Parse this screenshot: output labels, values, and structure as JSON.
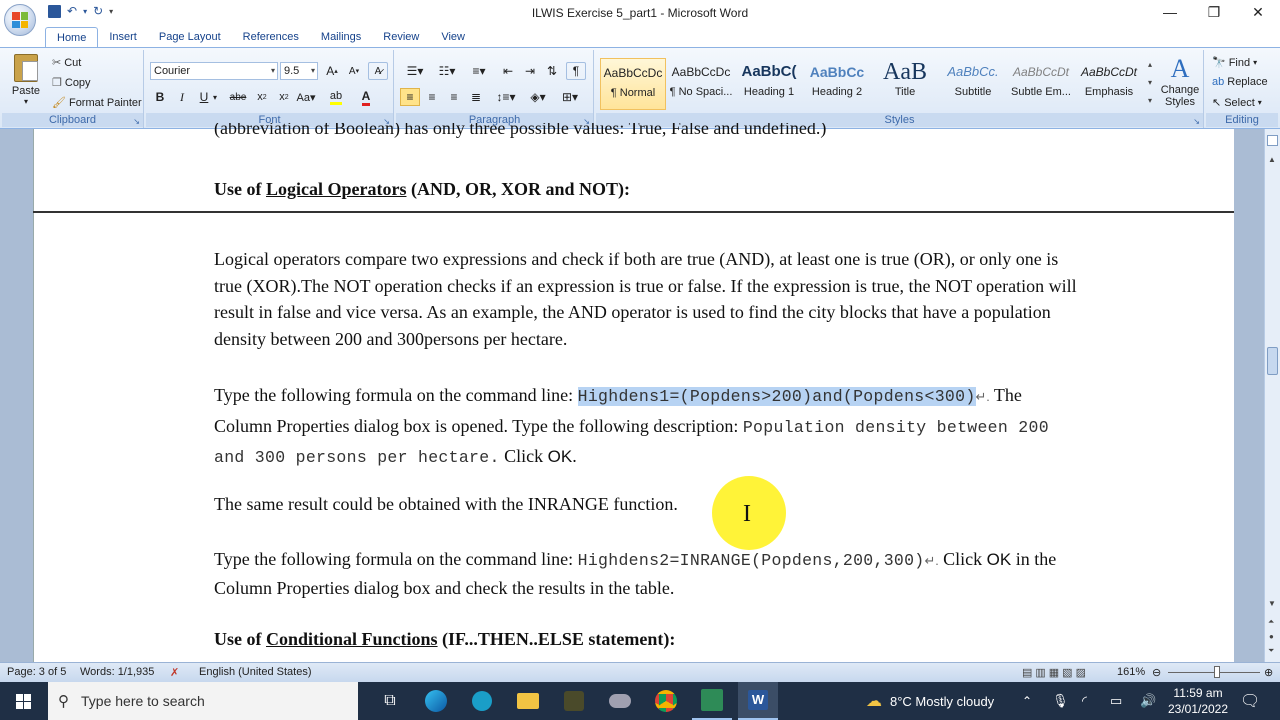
{
  "window": {
    "title": "ILWIS Exercise 5_part1 - Microsoft Word"
  },
  "tabs": [
    "Home",
    "Insert",
    "Page Layout",
    "References",
    "Mailings",
    "Review",
    "View"
  ],
  "clipboard": {
    "paste": "Paste",
    "cut": "Cut",
    "copy": "Copy",
    "format_painter": "Format Painter",
    "label": "Clipboard"
  },
  "font": {
    "name": "Courier",
    "size": "9.5",
    "label": "Font"
  },
  "paragraph": {
    "label": "Paragraph"
  },
  "styles": {
    "label": "Styles",
    "items": [
      {
        "preview": "AaBbCcDc",
        "name": "¶ Normal"
      },
      {
        "preview": "AaBbCcDc",
        "name": "¶ No Spaci..."
      },
      {
        "preview": "AaBbC(",
        "name": "Heading 1"
      },
      {
        "preview": "AaBbCc",
        "name": "Heading 2"
      },
      {
        "preview": "AaB",
        "name": "Title"
      },
      {
        "preview": "AaBbCc.",
        "name": "Subtitle"
      },
      {
        "preview": "AaBbCcDt",
        "name": "Subtle Em..."
      },
      {
        "preview": "AaBbCcDt",
        "name": "Emphasis"
      }
    ],
    "change": "Change Styles"
  },
  "editing": {
    "find": "Find",
    "replace": "Replace",
    "select": "Select",
    "label": "Editing"
  },
  "document": {
    "top_partial": "(abbreviation of Boolean) has only three possible values: True, False and undefined.)",
    "heading1_pre": "Use of ",
    "heading1_link": "Logical Operators",
    "heading1_post": " (AND, OR, XOR and NOT):",
    "para1": "Logical operators compare two expressions and check if both are true (AND), at least one is true (OR), or only one is true (XOR).The NOT operation checks if an expression is true or false. If the expression is true, the NOT operation will result in false and vice versa. As an example, the AND operator is used to find the city blocks that have a population density between 200 and 300persons per hectare.",
    "para2_pre": "Type the following formula on the command line: ",
    "para2_code": "Highdens1=(Popdens>200)and(Popdens<300)",
    "para2_mark": "↵.",
    "para2_mid": " The Column Properties dialog box is opened. Type the following description: ",
    "para2_code2": "Population density between 200 and 300 persons per hectare.",
    "para2_click": " Click ",
    "para2_ok": "OK",
    "para2_end": ".",
    "para3": "The same result could be obtained with the INRANGE function.",
    "para4_pre": "Type the following formula on the command line: ",
    "para4_code": "Highdens2=INRANGE(Popdens,200,300)",
    "para4_mark": "↵.",
    "para4_mid": "  Click ",
    "para4_ok": "OK",
    "para4_post": " in the Column Properties dialog box and check the results in the table.",
    "heading2_pre": "Use of ",
    "heading2_link": "Conditional Functions",
    "heading2_post": " (IF...THEN..ELSE statement):"
  },
  "status": {
    "page": "Page: 3 of 5",
    "words": "Words: 1/1,935",
    "language": "English (United States)",
    "zoom": "161%"
  },
  "taskbar": {
    "search_placeholder": "Type here to search",
    "weather": "8°C  Mostly cloudy",
    "time": "11:59 am",
    "date": "23/01/2022"
  }
}
